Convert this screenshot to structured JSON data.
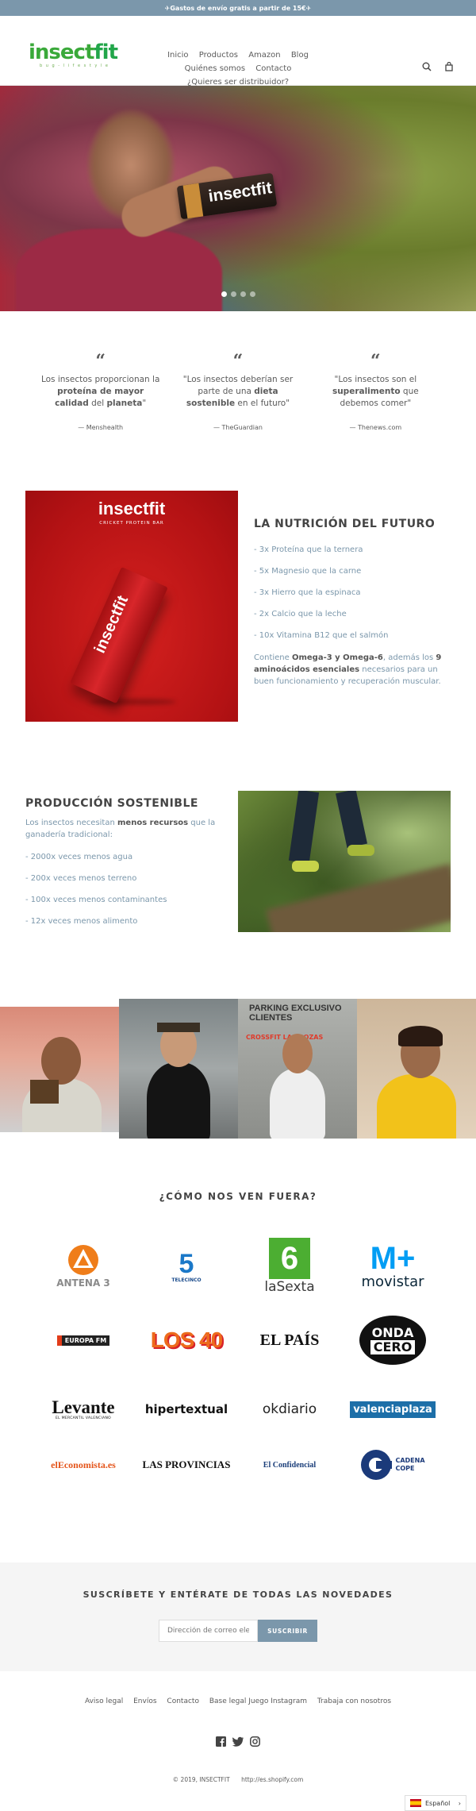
{
  "announcement": "✈Gastos de envío gratis a partir de 15€✈",
  "logo": {
    "brand_a": "insect",
    "brand_b": "fit",
    "tagline": "b u g - l i f e s t y l e"
  },
  "nav": {
    "items": [
      "Inicio",
      "Productos",
      "Amazon",
      "Blog",
      "Quiénes somos",
      "Contacto",
      "¿Quieres ser distribuidor?"
    ]
  },
  "hero": {
    "bar_text": "insectfit"
  },
  "quotes": [
    {
      "pre": "Los insectos proporcionan la ",
      "b1": "proteína de mayor calidad",
      "mid": " del ",
      "b2": "planeta",
      "post": "\"",
      "source": "— Menshealth"
    },
    {
      "pre": "\"Los insectos deberían ser parte de una ",
      "b1": "dieta sostenible",
      "mid": " en el futuro\"",
      "b2": "",
      "post": "",
      "source": "— TheGuardian"
    },
    {
      "pre": "\"Los insectos son el ",
      "b1": "superalimento",
      "mid": " que debemos comer\"",
      "b2": "",
      "post": "",
      "source": "— Thenews.com"
    }
  ],
  "nutrition": {
    "title": "LA NUTRICIÓN DEL FUTURO",
    "items": [
      "- 3x Proteína que la ternera",
      "- 5x Magnesio que la carne",
      "- 3x Hierro que la espinaca",
      "- 2x Calcio que la leche",
      "- 10x Vitamina B12 que el salmón"
    ],
    "p_pre": "Contiene ",
    "p_b1": "Omega-3 y Omega-6",
    "p_mid": ", además los ",
    "p_b2": "9 aminoácidos esenciales",
    "p_post": " necesarios para un buen funcionamiento y recuperación muscular.",
    "img_logo": "insectfit",
    "img_sub": "CRICKET PROTEIN BAR"
  },
  "production": {
    "title": "PRODUCCIÓN SOSTENIBLE",
    "p_pre": "Los insectos necesitan ",
    "p_b": "menos recursos",
    "p_post": " que la ganadería tradicional:",
    "items": [
      "- 2000x veces menos agua",
      "- 200x veces menos terreno",
      "- 100x veces menos contaminantes",
      "- 12x veces menos alimento"
    ]
  },
  "photos": {
    "sign": "PARKING EXCLUSIVO CLIENTES",
    "sign2": "CROSSFIT LAS ROZAS"
  },
  "press": {
    "title": "¿CÓMO NOS VEN FUERA?",
    "logos": {
      "antena3": "ANTENA 3",
      "telecinco": "TELECINCO",
      "lasexta": "laSexta",
      "movistar_m": "M+",
      "movistar": "movistar",
      "europafm": "EUROPA FM",
      "los40": "LOS 40",
      "elpais": "EL PAÍS",
      "onda1": "ONDA",
      "onda2": "CERO",
      "levante": "Levante",
      "levante_sub": "EL MERCANTIL VALENCIANO",
      "hipertextual": "hipertextual",
      "okdiario": "okdiario",
      "valenciaplaza": "valenciaplaza",
      "eleconomista": "elEconomista.es",
      "lasprovincias": "LAS PROVINCIAS",
      "elconfidencial": "El Confidencial",
      "cope1": "CADENA",
      "cope2": "COPE"
    }
  },
  "newsletter": {
    "title": "SUSCRÍBETE Y ENTÉRATE DE TODAS LAS NOVEDADES",
    "placeholder": "Dirección de correo ele",
    "button": "SUSCRIBIR"
  },
  "footer": {
    "links": [
      "Aviso legal",
      "Envíos",
      "Contacto",
      "Base legal Juego Instagram",
      "Trabaja con nosotros"
    ],
    "copyright": "© 2019, INSECTFIT",
    "shopify": "http://es.shopify.com"
  },
  "lang": {
    "label": "Español"
  },
  "colors": {
    "accent": "#7b97ab",
    "brand_green": "#3aa93a",
    "red": "#b41214"
  }
}
